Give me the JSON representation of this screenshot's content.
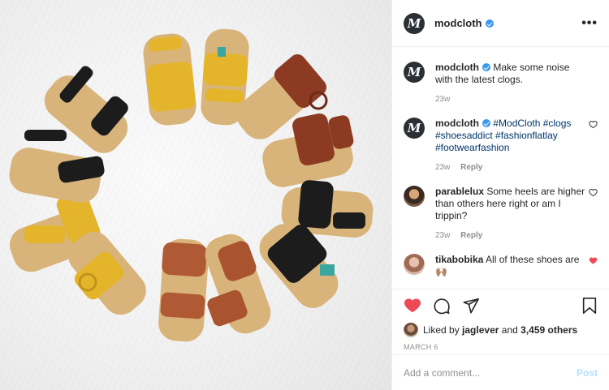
{
  "post": {
    "account": "modcloth",
    "verified": true,
    "more_label": "•••",
    "avatar_letter": "M"
  },
  "comments": [
    {
      "user": "modcloth",
      "text": "Make some noise with the latest clogs.",
      "time": "23w",
      "reply": "",
      "verified": true,
      "liked": false
    },
    {
      "user": "modcloth",
      "text": "#ModCloth #clogs #shoesaddict #fashionflatlay #footwearfashion",
      "time": "23w",
      "reply": "Reply",
      "verified": true,
      "liked": false
    },
    {
      "user": "parablelux",
      "text": "Some heels are higher than others here right or am I trippin?",
      "time": "23w",
      "reply": "Reply",
      "verified": false,
      "liked": false
    },
    {
      "user": "tikabobika",
      "text": "All of these shoes are",
      "emoji": "🙌🏽",
      "verified": false,
      "liked": true
    }
  ],
  "likes": {
    "prefix": "Liked by",
    "user": "jaglever",
    "connector": "and",
    "count": "3,459 others"
  },
  "date": "MARCH 6",
  "add_comment": {
    "placeholder": "Add a comment...",
    "post_label": "Post"
  },
  "colors": {
    "like_red": "#ed4956",
    "link_blue": "#003569",
    "verified_blue": "#3897f0",
    "post_disabled": "#b2dffc"
  },
  "icons": [
    "heart-filled-icon",
    "comment-icon",
    "share-icon",
    "bookmark-icon",
    "more-icon",
    "verified-icon",
    "heart-small-icon"
  ]
}
